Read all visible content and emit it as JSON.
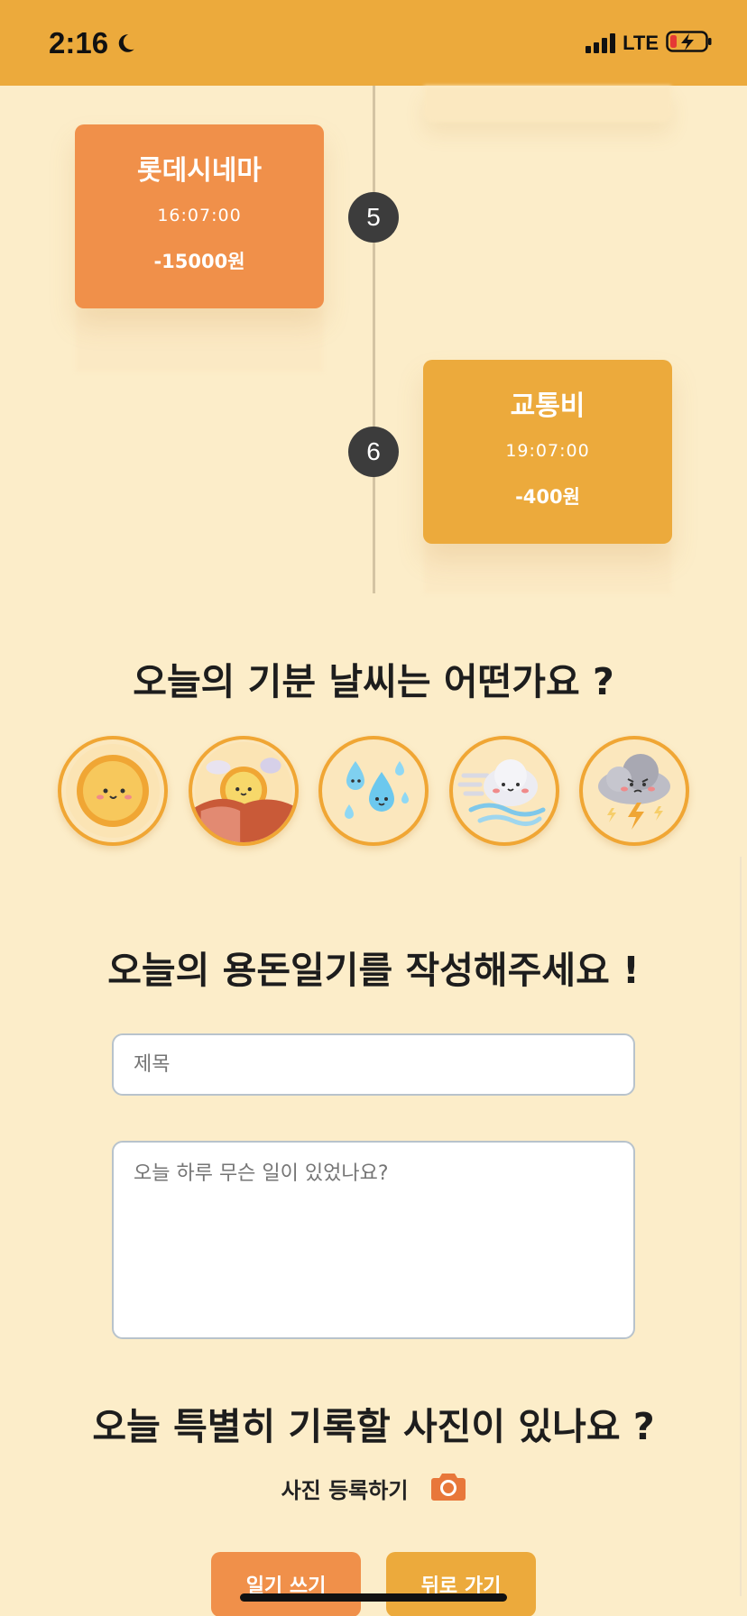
{
  "status_bar": {
    "time": "2:16",
    "network": "LTE",
    "battery_level": 0.15,
    "background_color": "#ECAA3C"
  },
  "timeline": {
    "entries": [
      {
        "index": "5",
        "name": "롯데시네마",
        "time": "16:07:00",
        "amount": "-15000원",
        "color": "#F0904A"
      },
      {
        "index": "6",
        "name": "교통비",
        "time": "19:07:00",
        "amount": "-400원",
        "color": "#ECAA3C"
      }
    ]
  },
  "mood": {
    "heading": "오늘의 기분 날씨는 어떤가요 ?",
    "options": [
      "sunny-face-icon",
      "sunset-face-icon",
      "raindrops-face-icon",
      "windy-cloud-face-icon",
      "thunderstorm-angry-cloud-icon"
    ]
  },
  "diary": {
    "heading": "오늘의 용돈일기를 작성해주세요 !",
    "title_placeholder": "제목",
    "title_value": "",
    "body_placeholder": "오늘 하루 무슨 일이 있었나요?",
    "body_value": ""
  },
  "photo": {
    "heading": "오늘 특별히 기록할 사진이 있나요 ?",
    "register_label": "사진 등록하기",
    "icon": "camera-icon",
    "icon_color": "#E8773A"
  },
  "actions": {
    "write_label": "일기 쓰기",
    "write_color": "#F0904A",
    "back_label": "뒤로 가기",
    "back_color": "#ECAA3C"
  }
}
